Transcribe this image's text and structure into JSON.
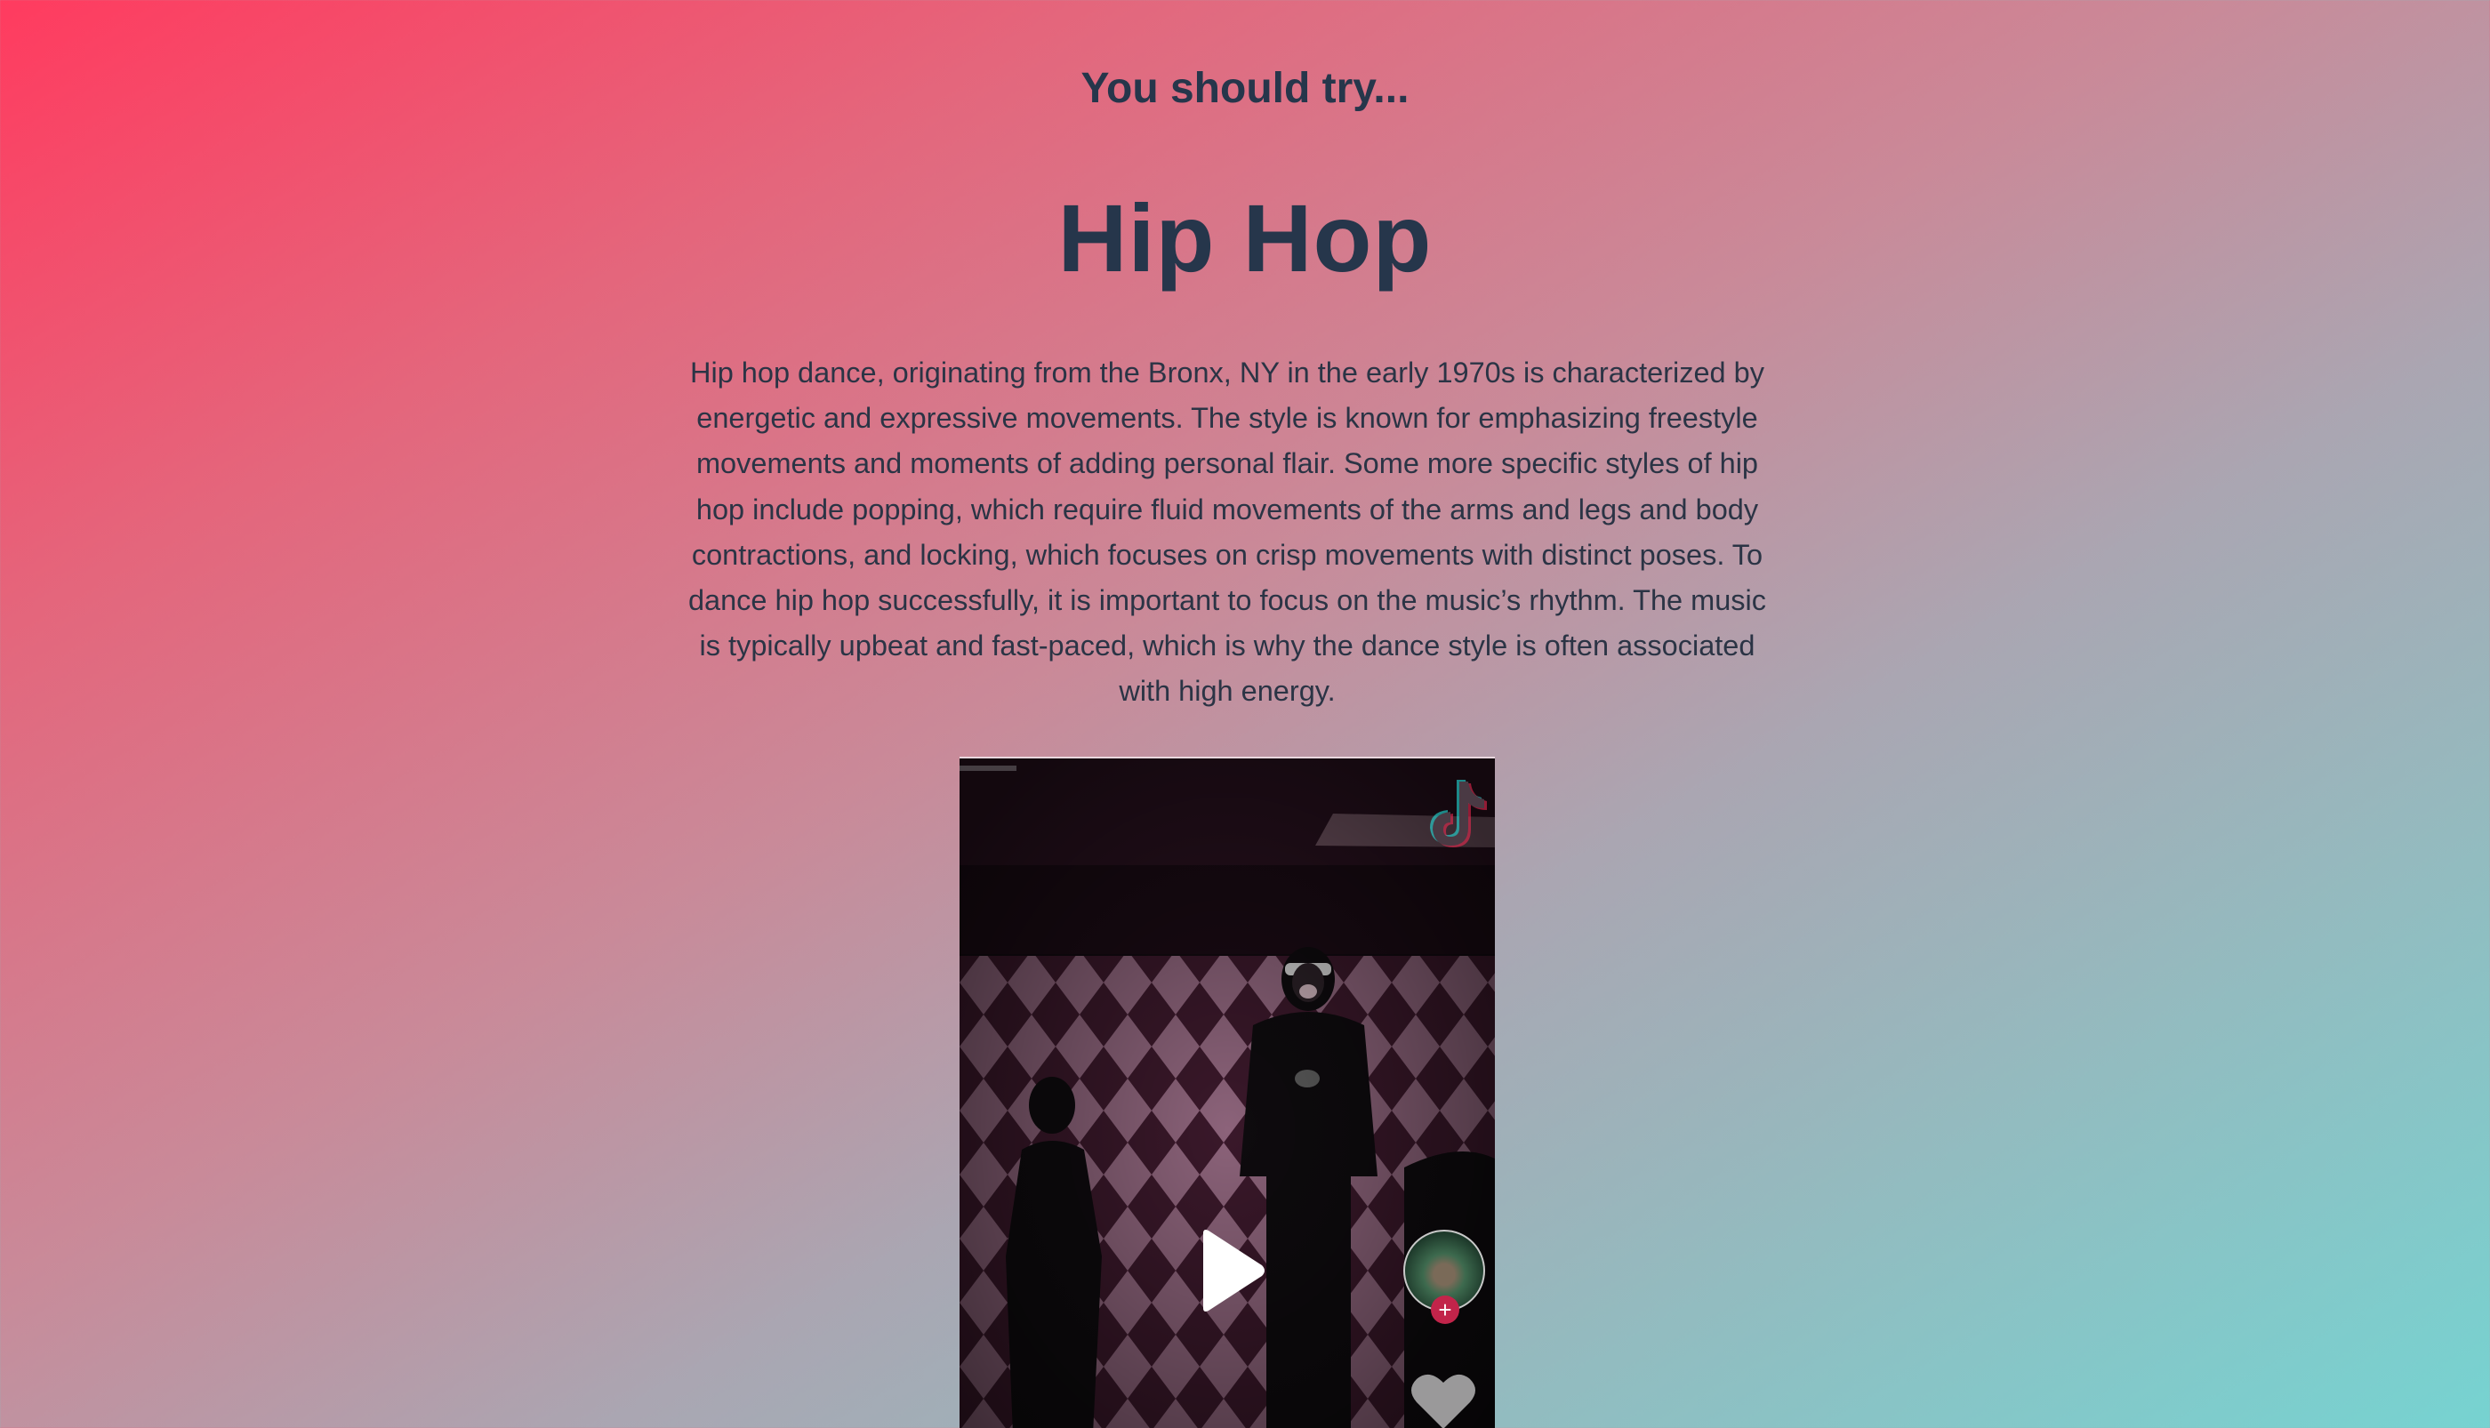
{
  "header": {
    "subtitle": "You should try...",
    "title": "Hip Hop"
  },
  "description": "Hip hop dance, originating from the Bronx, NY in the early 1970s is characterized by energetic and expressive movements. The style is known for emphasizing freestyle movements and moments of adding personal flair. Some more specific styles of hip hop include popping, which require fluid movements of the arms and legs and body contractions, and locking, which focuses on crisp movements with distinct poses. To dance hip hop successfully, it is important to focus on the music’s rhythm. The music is typically upbeat and fast-paced, which is why the dance style is often associated with high energy.",
  "video": {
    "platform_icon": "tiktok-logo-icon",
    "play_icon": "play-icon",
    "follow_symbol": "+",
    "like_icon": "heart-icon"
  },
  "colors": {
    "gradient_start": "#ff3b5f",
    "gradient_end": "#76d3d1",
    "heading": "#26364b",
    "follow_badge": "#c2244a"
  }
}
